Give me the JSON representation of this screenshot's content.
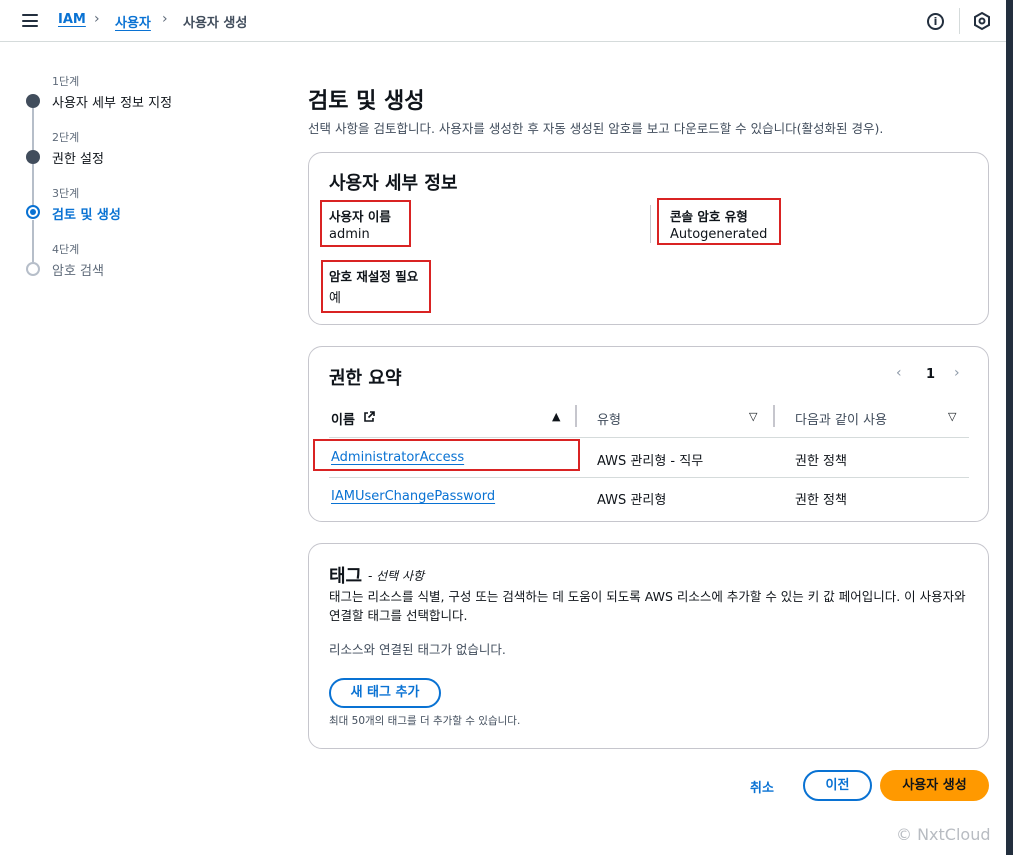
{
  "topbar": {
    "breadcrumb": [
      "IAM",
      "사용자",
      "사용자 생성"
    ],
    "info_icon": "i"
  },
  "steps": [
    {
      "label": "1단계",
      "title": "사용자 세부 정보 지정",
      "state": "done"
    },
    {
      "label": "2단계",
      "title": "권한 설정",
      "state": "done"
    },
    {
      "label": "3단계",
      "title": "검토 및 생성",
      "state": "active"
    },
    {
      "label": "4단계",
      "title": "암호 검색",
      "state": "todo"
    }
  ],
  "page": {
    "title": "검토 및 생성",
    "description": "선택 사항을 검토합니다. 사용자를 생성한 후 자동 생성된 암호를 보고 다운로드할 수 있습니다(활성화된 경우)."
  },
  "user_details": {
    "title": "사용자 세부 정보",
    "username_label": "사용자 이름",
    "username": "admin",
    "console_pw_label": "콘솔 암호 유형",
    "console_pw": "Autogenerated",
    "reset_label": "암호 재설정 필요",
    "reset": "예"
  },
  "permissions": {
    "title": "권한 요약",
    "page": "1",
    "prev": "‹",
    "next": "›",
    "columns": [
      "이름",
      "유형",
      "다음과 같이 사용"
    ],
    "sort_asc": "▲",
    "sort_desc": "▽",
    "rows": [
      {
        "name": "AdministratorAccess",
        "type": "AWS 관리형 - 직무",
        "used_as": "권한 정책"
      },
      {
        "name": "IAMUserChangePassword",
        "type": "AWS 관리형",
        "used_as": "권한 정책"
      }
    ]
  },
  "tags": {
    "title": "태그",
    "optional": "- 선택 사항",
    "description": "태그는 리소스를 식별, 구성 또는 검색하는 데 도움이 되도록 AWS 리소스에 추가할 수 있는 키 값 페어입니다. 이 사용자와 연결할 태그를 선택합니다.",
    "empty": "리소스와 연결된 태그가 없습니다.",
    "add_button": "새 태그 추가",
    "note": "최대 50개의 태그를 더 추가할 수 있습니다."
  },
  "footer": {
    "cancel": "취소",
    "previous": "이전",
    "create": "사용자 생성"
  },
  "watermark": "© NxtCloud",
  "colors": {
    "accent": "#0972d3",
    "primary": "#ff9900",
    "highlight": "#d92323"
  }
}
